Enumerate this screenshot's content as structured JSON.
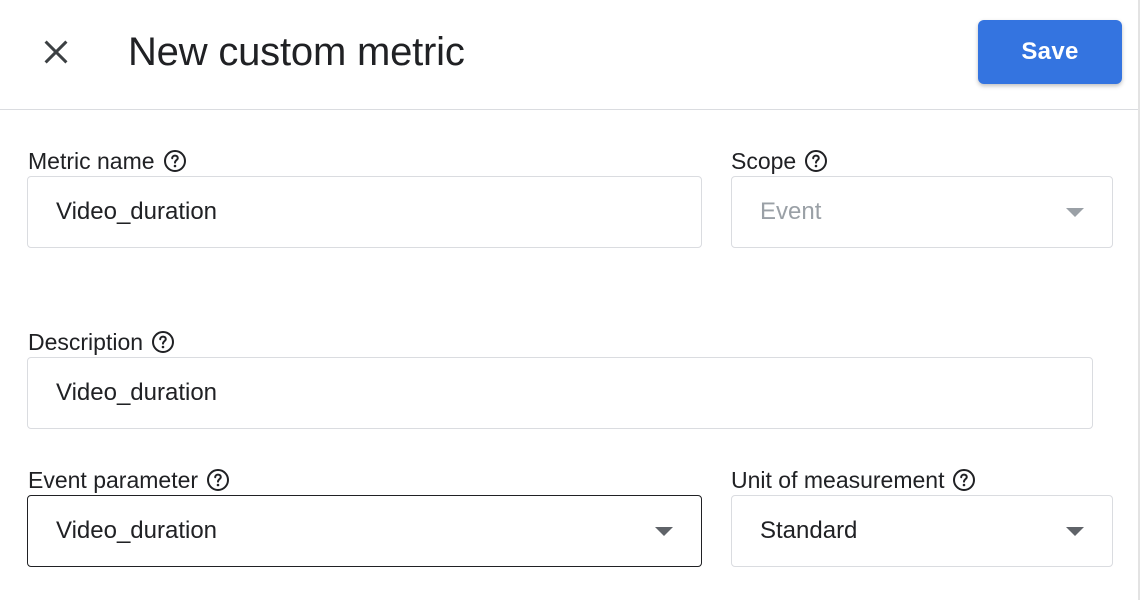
{
  "header": {
    "title": "New custom metric",
    "save_label": "Save"
  },
  "fields": {
    "metric_name": {
      "label": "Metric name",
      "value": "Video_duration"
    },
    "scope": {
      "label": "Scope",
      "value": "Event"
    },
    "description": {
      "label": "Description",
      "value": "Video_duration"
    },
    "event_parameter": {
      "label": "Event parameter",
      "value": "Video_duration"
    },
    "unit": {
      "label": "Unit of measurement",
      "value": "Standard"
    }
  },
  "icons": {
    "close": "close-icon",
    "help": "help-circle-icon",
    "dropdown": "caret-down-icon"
  },
  "colors": {
    "accent": "#3474e0",
    "text": "#202124",
    "border": "#dadce0",
    "disabled_text": "#9aa0a6"
  }
}
